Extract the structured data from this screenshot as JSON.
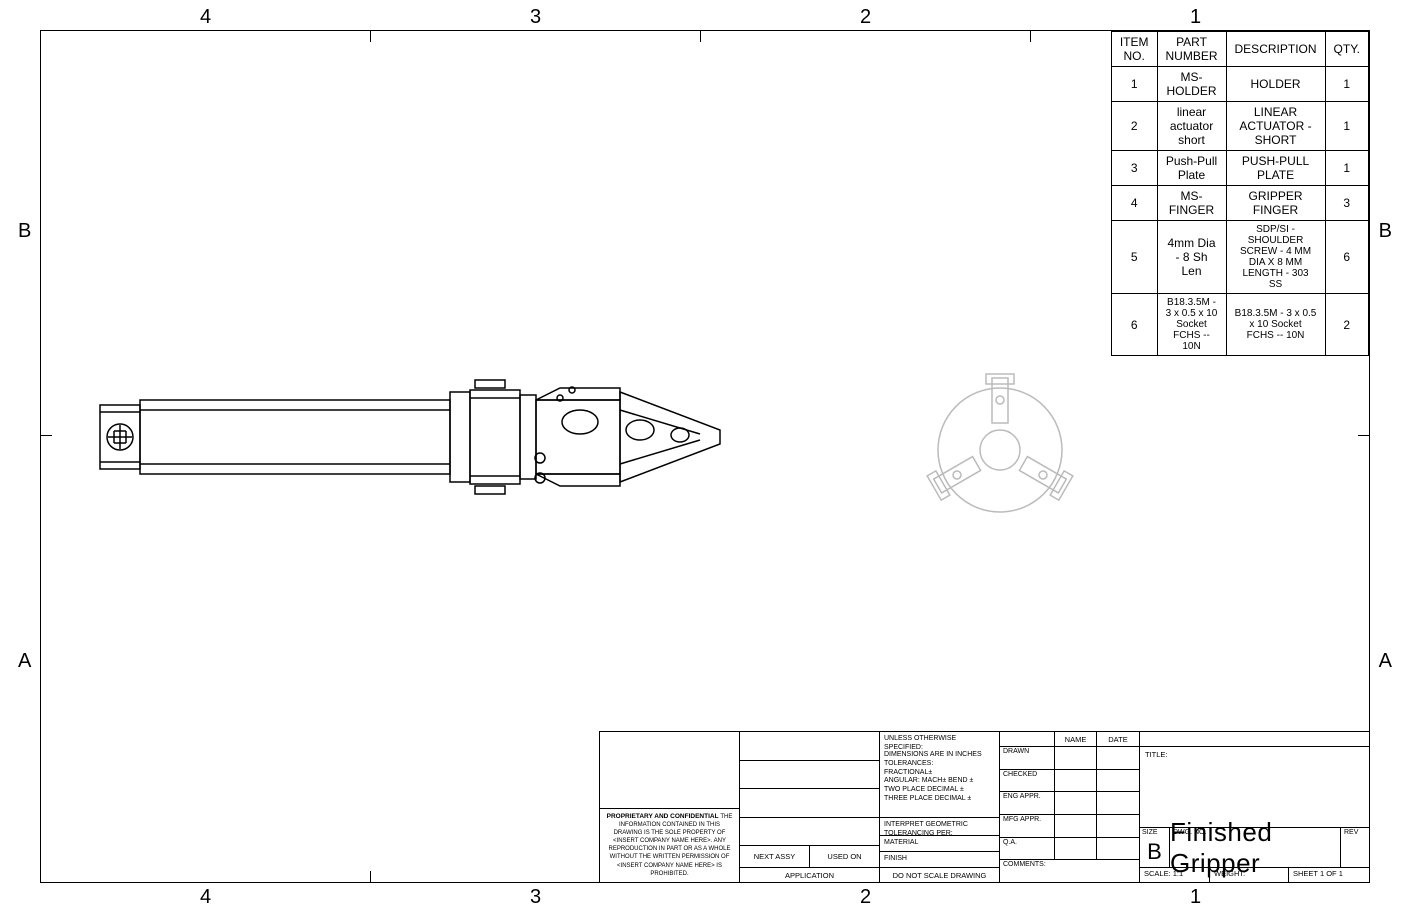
{
  "zones": {
    "top": [
      "4",
      "3",
      "2",
      "1"
    ],
    "bottom": [
      "4",
      "3",
      "2",
      "1"
    ],
    "left": [
      "B",
      "A"
    ],
    "right": [
      "B",
      "A"
    ]
  },
  "bom": {
    "headers": {
      "item": "ITEM NO.",
      "part": "PART NUMBER",
      "desc": "DESCRIPTION",
      "qty": "QTY."
    },
    "rows": [
      {
        "item": "1",
        "part": "MS-HOLDER",
        "desc": "HOLDER",
        "qty": "1"
      },
      {
        "item": "2",
        "part": "linear actuator short",
        "desc": "LINEAR ACTUATOR - SHORT",
        "qty": "1"
      },
      {
        "item": "3",
        "part": "Push-Pull Plate",
        "desc": "PUSH-PULL PLATE",
        "qty": "1"
      },
      {
        "item": "4",
        "part": "MS-FINGER",
        "desc": "GRIPPER FINGER",
        "qty": "3"
      },
      {
        "item": "5",
        "part": "4mm Dia -  8 Sh Len",
        "desc": "SDP/SI - SHOULDER SCREW - 4 MM DIA X 8 MM LENGTH - 303 SS",
        "qty": "6"
      },
      {
        "item": "6",
        "part": "B18.3.5M - 3 x 0.5 x 10 Socket FCHS  -- 10N",
        "desc": "B18.3.5M - 3 x 0.5 x 10 Socket FCHS -- 10N",
        "qty": "2"
      }
    ]
  },
  "title_block": {
    "proprietary_head": "PROPRIETARY AND CONFIDENTIAL",
    "proprietary_body": "THE INFORMATION CONTAINED IN THIS DRAWING IS THE SOLE PROPERTY OF <INSERT COMPANY NAME HERE>.  ANY REPRODUCTION IN PART OR AS A WHOLE WITHOUT THE WRITTEN PERMISSION OF <INSERT COMPANY NAME HERE> IS PROHIBITED.",
    "next_assy": "NEXT ASSY",
    "used_on": "USED ON",
    "application": "APPLICATION",
    "tol_head": "UNLESS OTHERWISE SPECIFIED:",
    "tol_body": "DIMENSIONS ARE IN INCHES\nTOLERANCES:\nFRACTIONAL±\nANGULAR: MACH±   BEND ±\nTWO PLACE DECIMAL   ±\nTHREE PLACE DECIMAL  ±",
    "interpret": "INTERPRET GEOMETRIC TOLERANCING PER:",
    "material": "MATERIAL",
    "finish": "FINISH",
    "do_not_scale": "DO NOT SCALE DRAWING",
    "sign_rows": [
      "DRAWN",
      "CHECKED",
      "ENG APPR.",
      "MFG APPR.",
      "Q.A.",
      "COMMENTS:"
    ],
    "name": "NAME",
    "date": "DATE",
    "title_label": "TITLE:",
    "drawing_title": "Finished Gripper",
    "size_label": "SIZE",
    "size_value": "B",
    "dwg_label": "DWG.  NO.",
    "rev": "REV",
    "scale": "SCALE: 1:1",
    "weight": "WEIGHT:",
    "sheet": "SHEET 1 OF 1"
  }
}
